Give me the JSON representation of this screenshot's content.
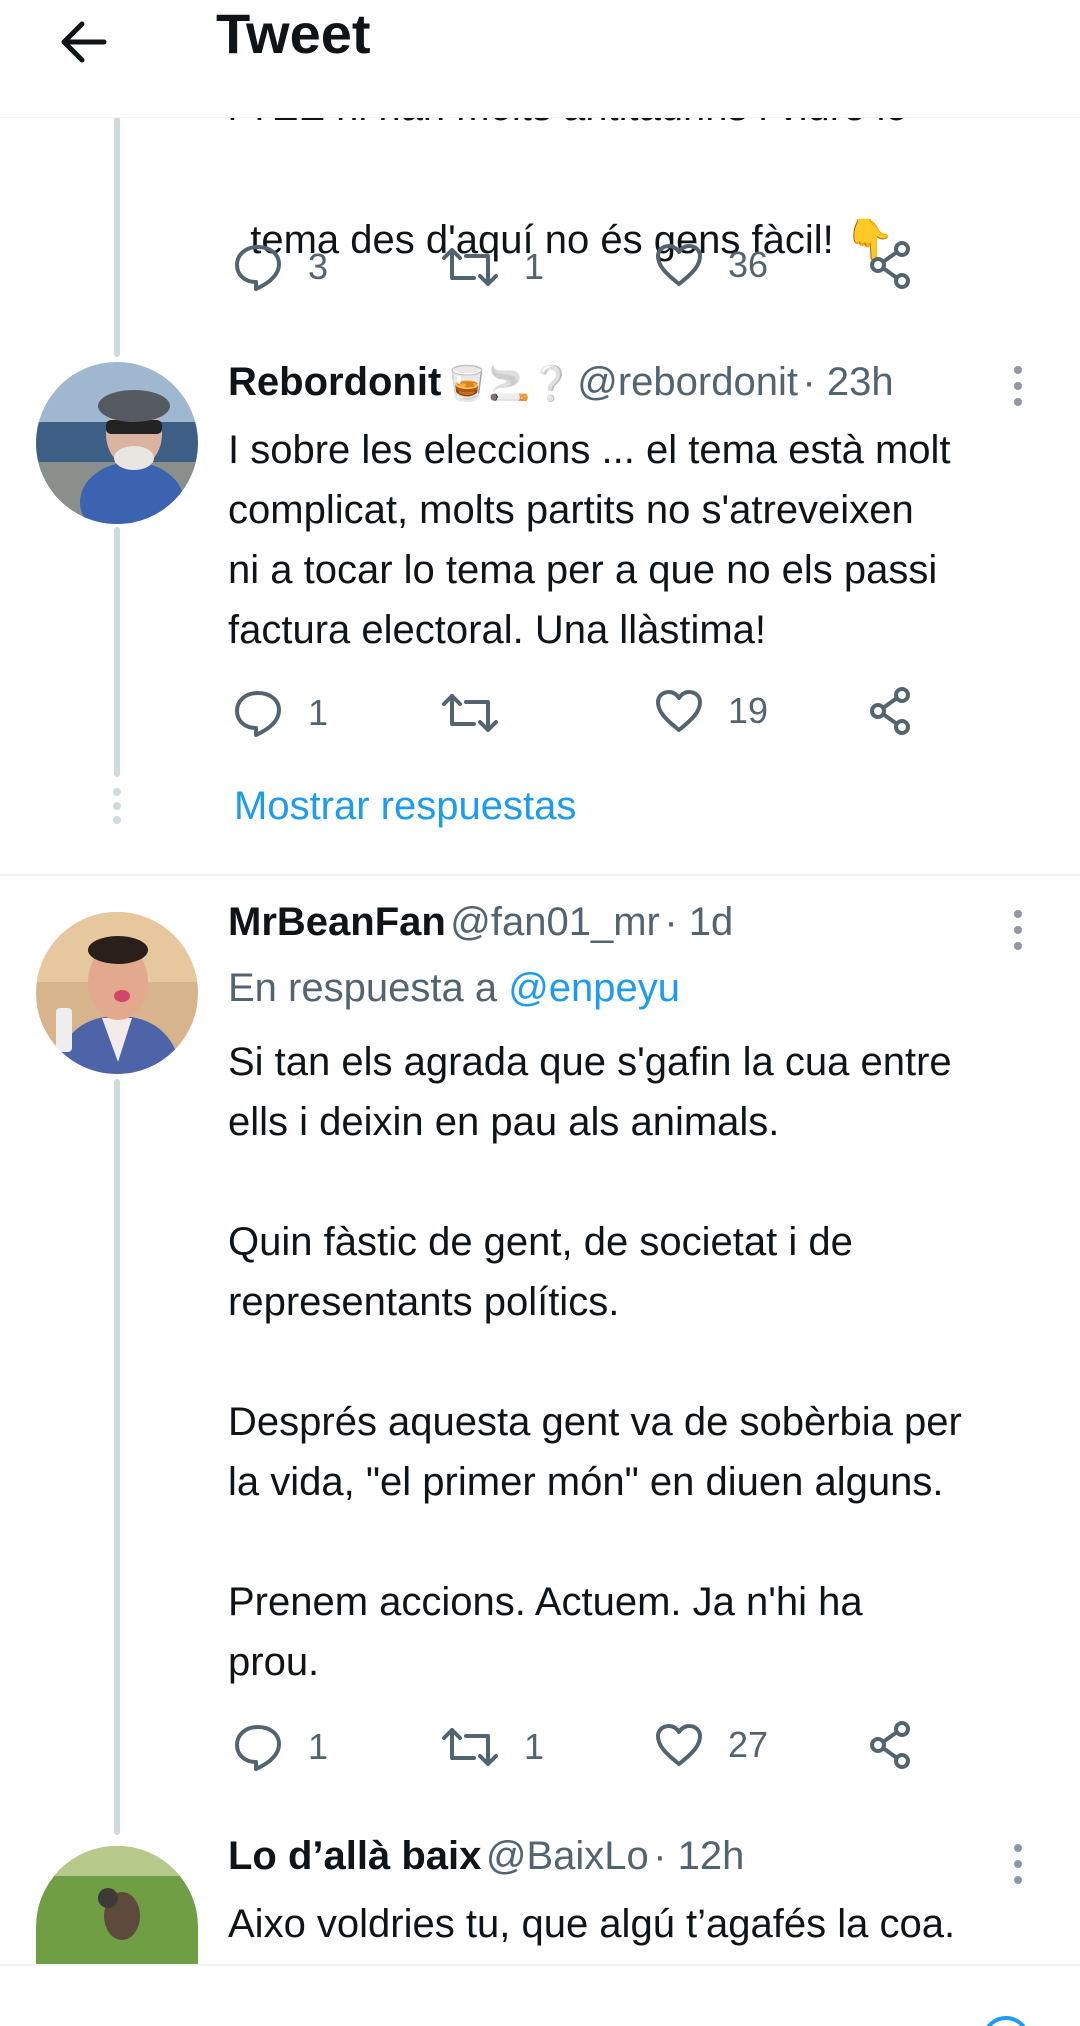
{
  "header": {
    "title": "Tweet"
  },
  "tweet0": {
    "partial_line": "i TEE ni han molts antitaurins i viure lo",
    "last_line": "tema des d'aquí no és gens fàcil!",
    "emoji": "👇",
    "actions": {
      "replies": "3",
      "retweets": "1",
      "likes": "36"
    }
  },
  "tweet1": {
    "name": "Rebordonit",
    "emoji": "🥃🚬❔",
    "handle": "@rebordonit",
    "time": "· 23h",
    "text": "I sobre les eleccions ... el tema està molt\ncomplicat, molts partits no s'atreveixen\nni a tocar lo tema per a que no els passi\nfactura electoral. Una llàstima!",
    "actions": {
      "replies": "1",
      "retweets": "",
      "likes": "19"
    },
    "show_replies": "Mostrar respuestas"
  },
  "tweet2": {
    "name": "MrBeanFan",
    "handle": "@fan01_mr",
    "time": "· 1d",
    "reply_prefix": "En respuesta a",
    "reply_to": "@enpeyu",
    "text": "Si tan els agrada que s'gafin la cua entre\nells i deixin en pau als animals.\n\nQuin fàstic de gent, de societat i de\nrepresentants polítics.\n\nDesprés aquesta gent va de sobèrbia per\nla vida, \"el primer món\" en diuen alguns.\n\nPrenem accions. Actuem. Ja n'hi ha\nprou.",
    "actions": {
      "replies": "1",
      "retweets": "1",
      "likes": "27"
    }
  },
  "tweet3": {
    "name": "Lo d’allà baix",
    "handle": "@BaixLo",
    "time": "· 12h",
    "text": "Aixo voldries tu, que algú t’agafés la coa."
  },
  "colors": {
    "accent": "#1d9bf0",
    "secondary_text": "#536471",
    "thread_line": "#cfd9de"
  }
}
